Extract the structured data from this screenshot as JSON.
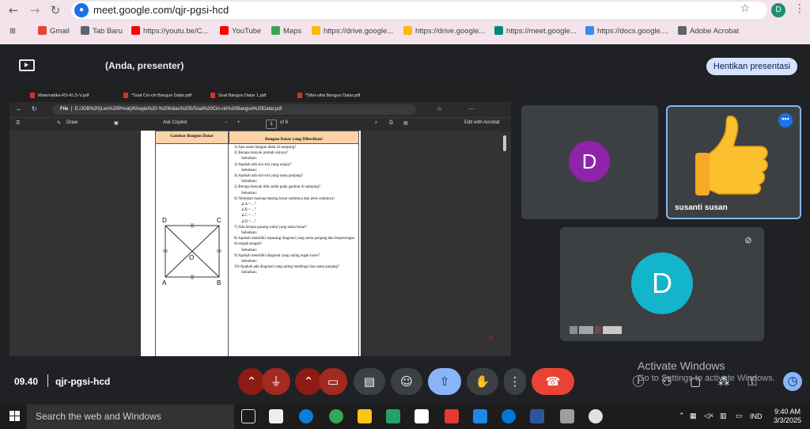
{
  "browser": {
    "url": "meet.google.com/qjr-pgsi-hcd",
    "profile_initial": "D",
    "bookmarks": [
      {
        "label": "Gmail",
        "color": "#ea4335"
      },
      {
        "label": "Tab Baru",
        "color": "#5f6368"
      },
      {
        "label": "https://youtu.be/C...",
        "color": "#ff0000"
      },
      {
        "label": "YouTube",
        "color": "#ff0000"
      },
      {
        "label": "Maps",
        "color": "#34a853"
      },
      {
        "label": "https://drive.google...",
        "color": "#fbbc04"
      },
      {
        "label": "https://drive.google...",
        "color": "#fbbc04"
      },
      {
        "label": "https://meet.google...",
        "color": "#00897b"
      },
      {
        "label": "https://docs.google....",
        "color": "#4285f4"
      },
      {
        "label": "Adobe Acrobat",
        "color": "#5f6368"
      }
    ]
  },
  "meet": {
    "presenter_label": "(Anda, presenter)",
    "stop_presenting": "Hentikan presentasi",
    "meeting_time": "09.40",
    "meeting_code": "qjr-pgsi-hcd",
    "participants": [
      {
        "initial": "D",
        "color": "#8e24aa"
      },
      {
        "name": "susanti susan",
        "color": "#3c4043"
      },
      {
        "initial": "D",
        "color": "#12b5cb"
      }
    ],
    "windows_watermark": {
      "line1": "Activate Windows",
      "line2": "Go to Settings to activate Windows."
    }
  },
  "shared_pdf": {
    "tabs": [
      "Matematika-RS-KLS-V.pdf",
      "*Soal Ciri-ciri Bangun Datar.pdf",
      "Soal Bangun Datar 1.pdf",
      "*Sifat-sifat Bangun Datar.pdf"
    ],
    "file_label": "File",
    "path": "E:/JOB%20(Les%20Privat)/Khayla%20-%20Kelas%205/Soal%20Ciri-ciri%20Bangun%20Datar.pdf",
    "toolbar": {
      "draw": "Draw",
      "ask_copilot": "Ask Copilot",
      "page": "1",
      "of_pages": "of 8",
      "edit": "Edit with Acrobat"
    },
    "header_left": "Gambar Bangun Datar",
    "header_right": "Bangun Datar yang Diberikan!",
    "vertices": {
      "D": "D",
      "C": "C",
      "A": "A",
      "B": "B",
      "O": "O"
    },
    "questions": [
      "1)  Apa nama bangun datar di samping?",
      "2)  Berapa banyak jumlah sisinya?",
      "Sebutkan:",
      "3)  Apakah ada sisi-sisi yang sejajar?",
      "Sebutkan:",
      "4)  Apakah ada sisi-sisi yang sama panjang?",
      "Sebutkan:",
      "5)  Berapa banyak titik sudut pada gambar di samping?",
      "Sebutkan:",
      "6)  Tentukan masing-masing besar sudutnya dan jenis sudutnya!",
      "∠A = ...°",
      "∠B = ...°",
      "∠C = ...°",
      "∠D = ...°",
      "7)  Ada berapa pasang sudut yang sama besar?",
      "Sebutkan:",
      "8)  Apakah memiliki sepasang diagonal yang sama panjang dan berpotongan di tengah tengah?",
      "Sebutkan:",
      "9)  Apakah memiliki diagonal yang saling tegak lurus?",
      "Sebutkan:",
      "10) Apakah ada diagonal yang saling membagi dua sama panjang?",
      "Sebutkan:"
    ]
  },
  "taskbar": {
    "search": "Search the web and Windows",
    "lang": "IND",
    "time": "9:40 AM",
    "date": "3/3/2025"
  }
}
